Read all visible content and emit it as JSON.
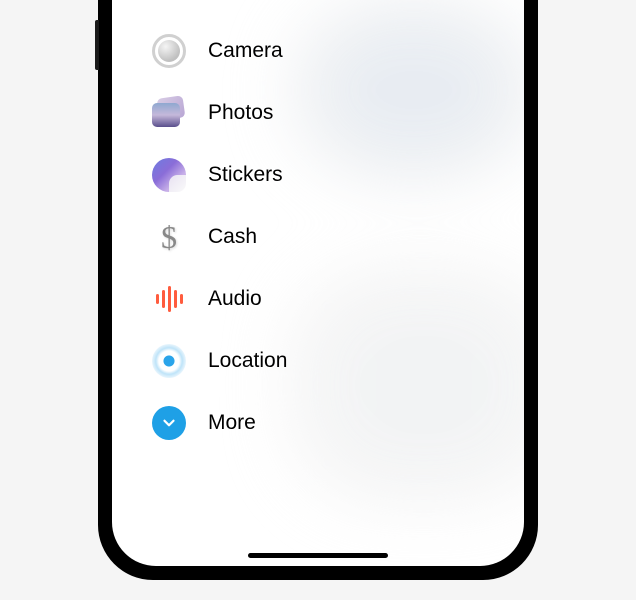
{
  "menu": {
    "items": [
      {
        "label": "Camera",
        "icon": "camera-icon"
      },
      {
        "label": "Photos",
        "icon": "photos-icon"
      },
      {
        "label": "Stickers",
        "icon": "stickers-icon"
      },
      {
        "label": "Cash",
        "icon": "cash-icon"
      },
      {
        "label": "Audio",
        "icon": "audio-icon"
      },
      {
        "label": "Location",
        "icon": "location-icon"
      },
      {
        "label": "More",
        "icon": "more-icon"
      }
    ]
  }
}
